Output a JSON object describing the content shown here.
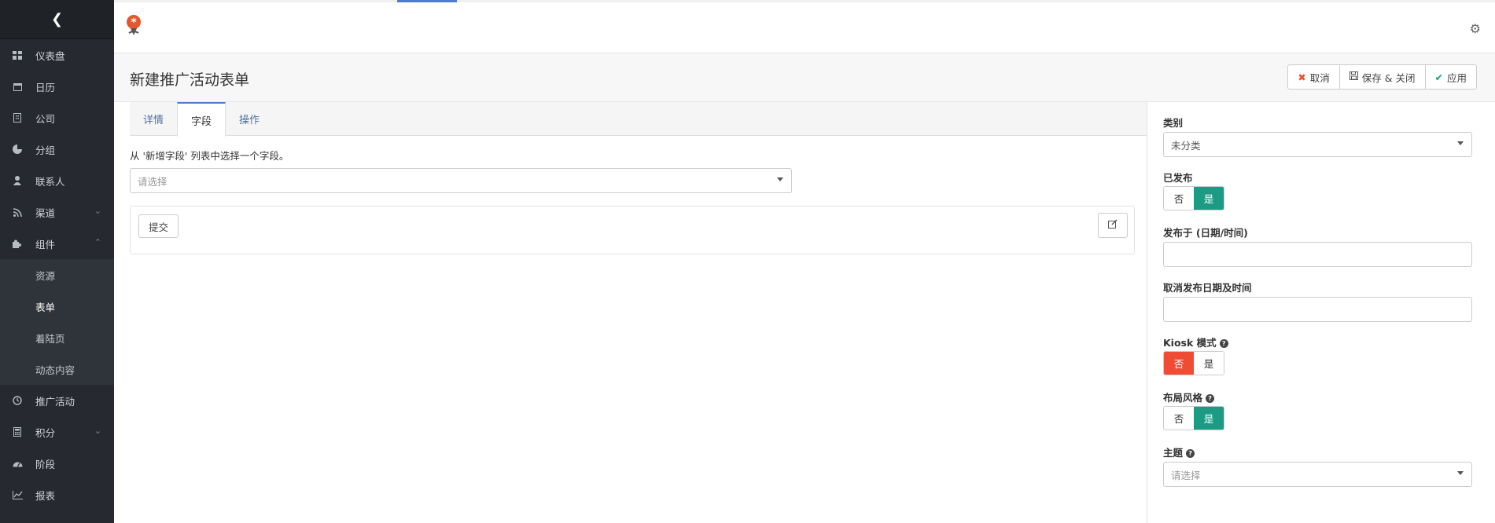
{
  "sidebar": {
    "collapse_icon": "chevron-left-icon",
    "items": [
      {
        "label": "仪表盘",
        "icon": "dashboard-icon"
      },
      {
        "label": "日历",
        "icon": "calendar-icon"
      },
      {
        "label": "公司",
        "icon": "building-icon"
      },
      {
        "label": "分组",
        "icon": "pie-chart-icon"
      },
      {
        "label": "联系人",
        "icon": "user-icon"
      },
      {
        "label": "渠道",
        "icon": "rss-icon"
      },
      {
        "label": "组件",
        "icon": "puzzle-icon"
      },
      {
        "label": "资源"
      },
      {
        "label": "表单"
      },
      {
        "label": "着陆页"
      },
      {
        "label": "动态内容"
      },
      {
        "label": "推广活动",
        "icon": "clock-icon"
      },
      {
        "label": "积分",
        "icon": "calculator-icon"
      },
      {
        "label": "阶段",
        "icon": "gauge-icon"
      },
      {
        "label": "报表",
        "icon": "line-chart-icon"
      }
    ]
  },
  "page": {
    "title": "新建推广活动表单"
  },
  "toolbar": {
    "cancel_label": "取消",
    "save_close_label": "保存 & 关闭",
    "apply_label": "应用"
  },
  "tabs": [
    {
      "label": "详情"
    },
    {
      "label": "字段"
    },
    {
      "label": "操作"
    }
  ],
  "fields_tab": {
    "hint": "从 '新增字段' 列表中选择一个字段。",
    "select_placeholder": "请选择",
    "submit_label": "提交"
  },
  "right_panel": {
    "category_label": "类别",
    "category_value": "未分类",
    "published_label": "已发布",
    "publish_up_label": "发布于 (日期/时间)",
    "publish_down_label": "取消发布日期及时间",
    "kiosk_label": "Kiosk 模式",
    "layout_label": "布局风格",
    "theme_label": "主题",
    "theme_placeholder": "请选择",
    "no_label": "否",
    "yes_label": "是",
    "published_value": "是",
    "kiosk_value": "否",
    "layout_value": "是"
  },
  "colors": {
    "sidebar_bg": "#262a30",
    "accent_blue": "#4e7bd0",
    "toggle_green": "#1b9a84",
    "toggle_red": "#ef4b35"
  }
}
